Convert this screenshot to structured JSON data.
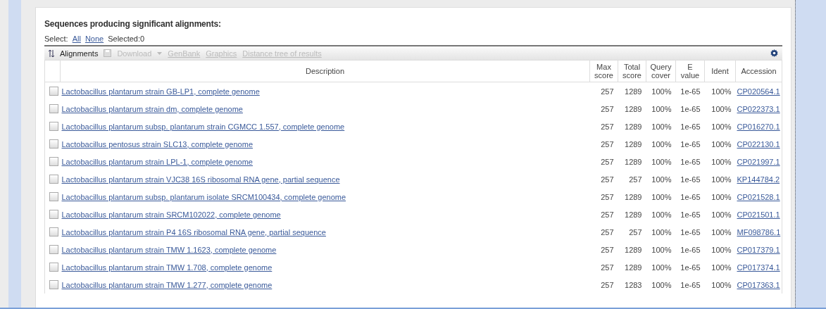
{
  "title": "Sequences producing significant alignments:",
  "select": {
    "label": "Select:",
    "links": [
      "All",
      "None"
    ],
    "selected_count": "Selected:0"
  },
  "toolbar": [
    {
      "kind": "sort",
      "label": "Alignments",
      "disabled": false
    },
    {
      "kind": "download",
      "label": "Download",
      "disabled": true
    },
    {
      "kind": "link",
      "label": "GenBank",
      "disabled": true
    },
    {
      "kind": "link",
      "label": "Graphics",
      "disabled": true
    },
    {
      "kind": "link",
      "label": "Distance tree of results",
      "disabled": true
    }
  ],
  "table": {
    "columns": [
      "Description",
      "Max score",
      "Total score",
      "Query cover",
      "E value",
      "Ident",
      "Accession"
    ],
    "rows": [
      {
        "checked": false,
        "description": "Lactobacillus plantarum strain GB-LP1, complete genome",
        "max_score": "257",
        "total_score": "1289",
        "query_cover": "100%",
        "e_value": "1e-65",
        "ident": "100%",
        "accession": "CP020564.1"
      },
      {
        "checked": false,
        "description": "Lactobacillus plantarum strain dm, complete genome",
        "max_score": "257",
        "total_score": "1289",
        "query_cover": "100%",
        "e_value": "1e-65",
        "ident": "100%",
        "accession": "CP022373.1"
      },
      {
        "checked": false,
        "description": "Lactobacillus plantarum subsp. plantarum strain CGMCC 1.557, complete genome",
        "max_score": "257",
        "total_score": "1289",
        "query_cover": "100%",
        "e_value": "1e-65",
        "ident": "100%",
        "accession": "CP016270.1"
      },
      {
        "checked": false,
        "description": "Lactobacillus pentosus strain SLC13, complete genome",
        "max_score": "257",
        "total_score": "1289",
        "query_cover": "100%",
        "e_value": "1e-65",
        "ident": "100%",
        "accession": "CP022130.1"
      },
      {
        "checked": false,
        "description": "Lactobacillus plantarum strain LPL-1, complete genome",
        "max_score": "257",
        "total_score": "1289",
        "query_cover": "100%",
        "e_value": "1e-65",
        "ident": "100%",
        "accession": "CP021997.1"
      },
      {
        "checked": false,
        "description": "Lactobacillus plantarum strain VJC38 16S ribosomal RNA gene, partial sequence",
        "max_score": "257",
        "total_score": "257",
        "query_cover": "100%",
        "e_value": "1e-65",
        "ident": "100%",
        "accession": "KP144784.2"
      },
      {
        "checked": false,
        "description": "Lactobacillus plantarum subsp. plantarum isolate SRCM100434, complete genome",
        "max_score": "257",
        "total_score": "1289",
        "query_cover": "100%",
        "e_value": "1e-65",
        "ident": "100%",
        "accession": "CP021528.1"
      },
      {
        "checked": false,
        "description": "Lactobacillus plantarum strain SRCM102022, complete genome",
        "max_score": "257",
        "total_score": "1289",
        "query_cover": "100%",
        "e_value": "1e-65",
        "ident": "100%",
        "accession": "CP021501.1"
      },
      {
        "checked": false,
        "description": "Lactobacillus plantarum strain P4 16S ribosomal RNA gene, partial sequence",
        "max_score": "257",
        "total_score": "257",
        "query_cover": "100%",
        "e_value": "1e-65",
        "ident": "100%",
        "accession": "MF098786.1"
      },
      {
        "checked": false,
        "description": "Lactobacillus plantarum strain TMW 1.1623, complete genome",
        "max_score": "257",
        "total_score": "1289",
        "query_cover": "100%",
        "e_value": "1e-65",
        "ident": "100%",
        "accession": "CP017379.1"
      },
      {
        "checked": false,
        "description": "Lactobacillus plantarum strain TMW 1.708, complete genome",
        "max_score": "257",
        "total_score": "1289",
        "query_cover": "100%",
        "e_value": "1e-65",
        "ident": "100%",
        "accession": "CP017374.1"
      },
      {
        "checked": false,
        "description": "Lactobacillus plantarum strain TMW 1.277, complete genome",
        "max_score": "257",
        "total_score": "1283",
        "query_cover": "100%",
        "e_value": "1e-65",
        "ident": "100%",
        "accession": "CP017363.1"
      }
    ]
  }
}
